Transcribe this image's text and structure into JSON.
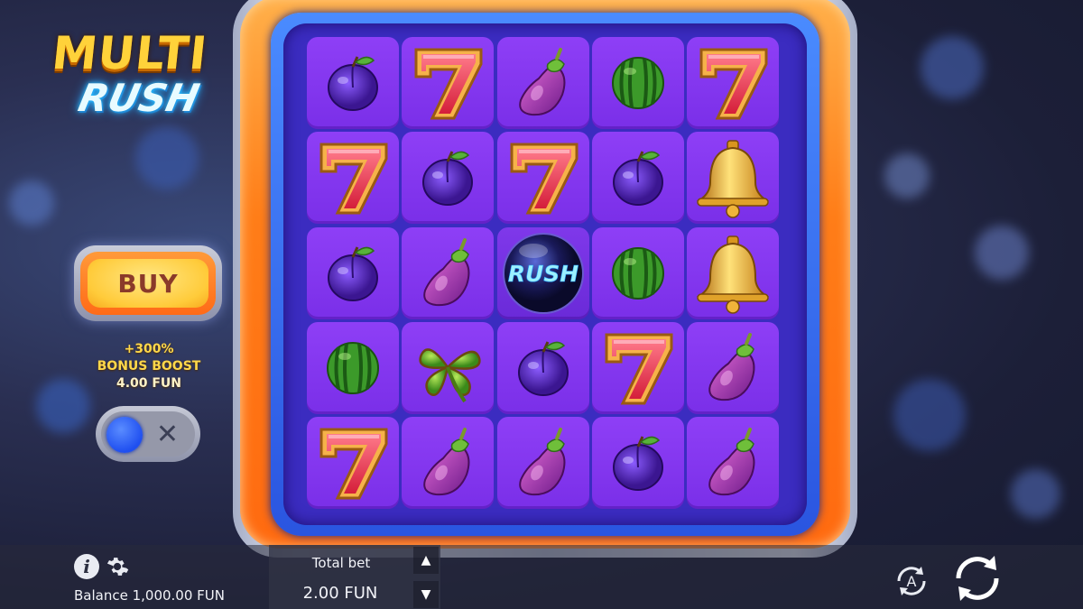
{
  "game": {
    "logo_line1": "MULTI",
    "logo_line2": "RUSH"
  },
  "buy_button": {
    "label": "BUY"
  },
  "bonus_boost": {
    "percent": "+300%",
    "label": "BONUS BOOST",
    "cost": "4.00 FUN",
    "toggle_on": false
  },
  "grid": {
    "columns": 5,
    "rows": 5,
    "cells": [
      [
        "plum",
        "seven",
        "eggplant",
        "watermelon",
        "seven"
      ],
      [
        "seven",
        "plum",
        "seven",
        "plum",
        "bell"
      ],
      [
        "plum",
        "eggplant",
        "rush-orb",
        "watermelon",
        "bell"
      ],
      [
        "watermelon",
        "clover",
        "plum",
        "seven",
        "eggplant"
      ],
      [
        "seven",
        "eggplant",
        "eggplant",
        "plum",
        "eggplant"
      ]
    ],
    "rush_text": "RUSH"
  },
  "bottom_bar": {
    "balance_text": "Balance 1,000.00 FUN",
    "total_bet_label": "Total bet",
    "total_bet_value": "2.00 FUN",
    "info_icon": "info-icon",
    "settings_icon": "gear-icon",
    "autoplay_icon": "autoplay-icon",
    "spin_icon": "spin-icon"
  },
  "colors": {
    "frame_orange": "#ff7d18",
    "frame_blue": "#2a55e0",
    "cell_purple": "#8338ef",
    "buy_yellow": "#ffcb3a"
  }
}
